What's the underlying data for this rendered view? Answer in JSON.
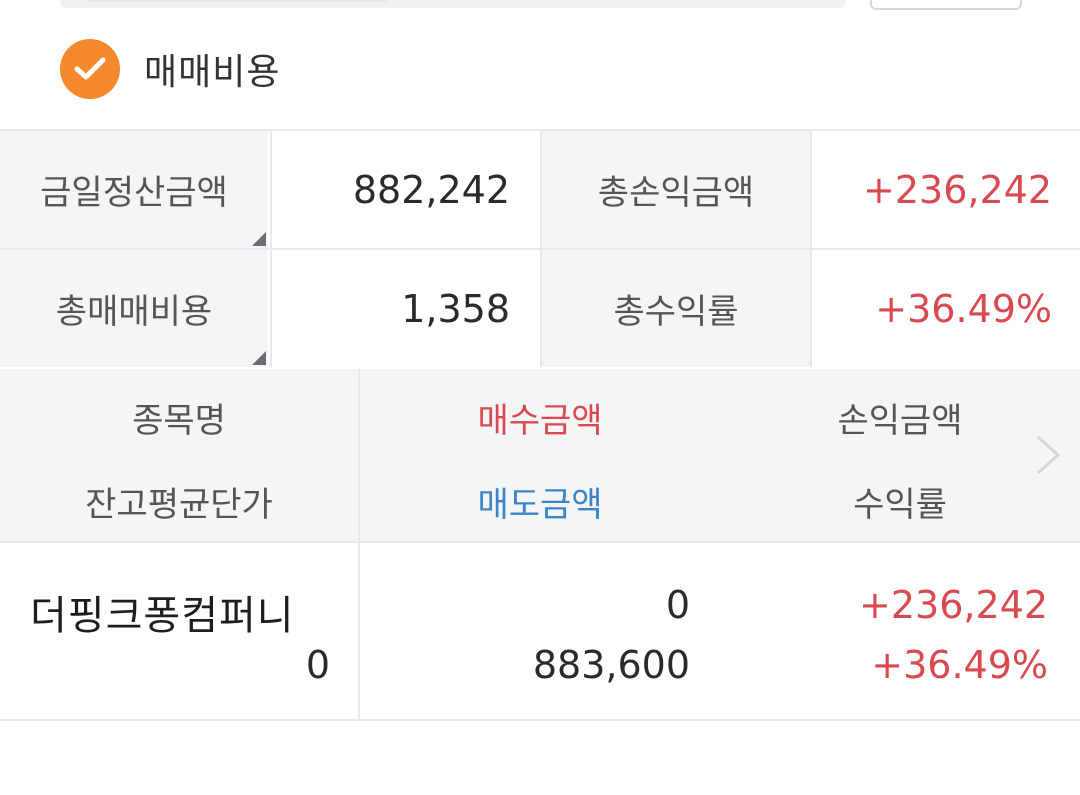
{
  "checkbox": {
    "label": "매매비용",
    "checked": true,
    "color": "#f4892b"
  },
  "summary": {
    "today_settlement": {
      "label": "금일정산금액",
      "value": "882,242"
    },
    "total_pl": {
      "label": "총손익금액",
      "value": "+236,242"
    },
    "total_cost": {
      "label": "총매매비용",
      "value": "1,358"
    },
    "total_return": {
      "label": "총수익률",
      "value": "+36.49%"
    }
  },
  "table": {
    "headers": {
      "col1_top": "종목명",
      "col1_bottom": "잔고평균단가",
      "col2_top": "매수금액",
      "col2_bottom": "매도금액",
      "col3_top": "손익금액",
      "col3_bottom": "수익률"
    },
    "rows": [
      {
        "name": "더핑크퐁컴퍼니",
        "avg_price": "0",
        "buy_amount": "0",
        "sell_amount": "883,600",
        "pl_amount": "+236,242",
        "return_rate": "+36.49%"
      }
    ]
  },
  "colors": {
    "positive": "#d9494f",
    "sell": "#3b85c8",
    "header_bg": "#f4f5f7"
  }
}
